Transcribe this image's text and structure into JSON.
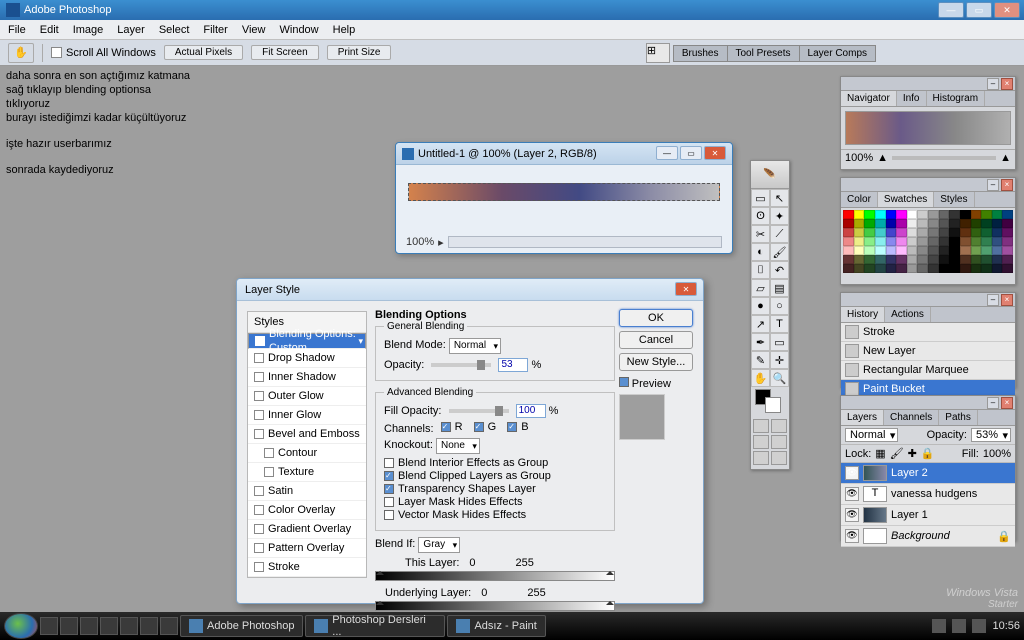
{
  "app_title": "Adobe Photoshop",
  "menu": [
    "File",
    "Edit",
    "Image",
    "Layer",
    "Select",
    "Filter",
    "View",
    "Window",
    "Help"
  ],
  "optionsbar": {
    "scroll_all": "Scroll All Windows",
    "actual_pixels": "Actual Pixels",
    "fit_screen": "Fit Screen",
    "print_size": "Print Size"
  },
  "right_tabs": [
    "Brushes",
    "Tool Presets",
    "Layer Comps"
  ],
  "bgtext": [
    "daha sonra en son açtığımız katmana",
    "sağ tıklayıp blending optionsa",
    "tıklıyoruz",
    "burayı istediğimzi kadar küçültüyoruz",
    "",
    "işte hazır userbarımız",
    "",
    "sonrada kaydediyoruz"
  ],
  "doc": {
    "title": "Untitled-1 @ 100% (Layer 2, RGB/8)",
    "zoom": "100%"
  },
  "layerstyle": {
    "title": "Layer Style",
    "left": {
      "header": "Styles",
      "selected": "Blending Options: Custom",
      "items": [
        "Drop Shadow",
        "Inner Shadow",
        "Outer Glow",
        "Inner Glow",
        "Bevel and Emboss",
        "Contour",
        "Texture",
        "Satin",
        "Color Overlay",
        "Gradient Overlay",
        "Pattern Overlay",
        "Stroke"
      ]
    },
    "blending": {
      "heading": "Blending Options",
      "general": "General Blending",
      "blend_mode_label": "Blend Mode:",
      "blend_mode": "Normal",
      "opacity_label": "Opacity:",
      "opacity": "53",
      "advanced": "Advanced Blending",
      "fill_opacity_label": "Fill Opacity:",
      "fill_opacity": "100",
      "channels_label": "Channels:",
      "ch_r": "R",
      "ch_g": "G",
      "ch_b": "B",
      "knockout_label": "Knockout:",
      "knockout": "None",
      "cb1": "Blend Interior Effects as Group",
      "cb2": "Blend Clipped Layers as Group",
      "cb3": "Transparency Shapes Layer",
      "cb4": "Layer Mask Hides Effects",
      "cb5": "Vector Mask Hides Effects",
      "blendif_label": "Blend If:",
      "blendif": "Gray",
      "thislayer": "This Layer:",
      "underlying": "Underlying Layer:",
      "v0": "0",
      "v255": "255"
    },
    "buttons": {
      "ok": "OK",
      "cancel": "Cancel",
      "newstyle": "New Style...",
      "preview": "Preview"
    }
  },
  "navigator": {
    "tabs": [
      "Navigator",
      "Info",
      "Histogram"
    ],
    "zoom": "100%"
  },
  "swatches": {
    "tabs": [
      "Color",
      "Swatches",
      "Styles"
    ]
  },
  "history": {
    "tabs": [
      "History",
      "Actions"
    ],
    "items": [
      "Stroke",
      "New Layer",
      "Rectangular Marquee",
      "Paint Bucket"
    ]
  },
  "layers": {
    "tabs": [
      "Layers",
      "Channels",
      "Paths"
    ],
    "mode": "Normal",
    "opacity_label": "Opacity:",
    "opacity": "53%",
    "lock_label": "Lock:",
    "fill_label": "Fill:",
    "fill": "100%",
    "items": [
      "Layer 2",
      "vanessa hudgens",
      "Layer 1",
      "Background"
    ]
  },
  "watermark": {
    "l1": "Windows Vista",
    "l2": "Starter"
  },
  "taskbar": {
    "items": [
      "Adobe Photoshop",
      "Photoshop Dersleri ...",
      "Adsız - Paint"
    ],
    "clock": "10:56"
  }
}
